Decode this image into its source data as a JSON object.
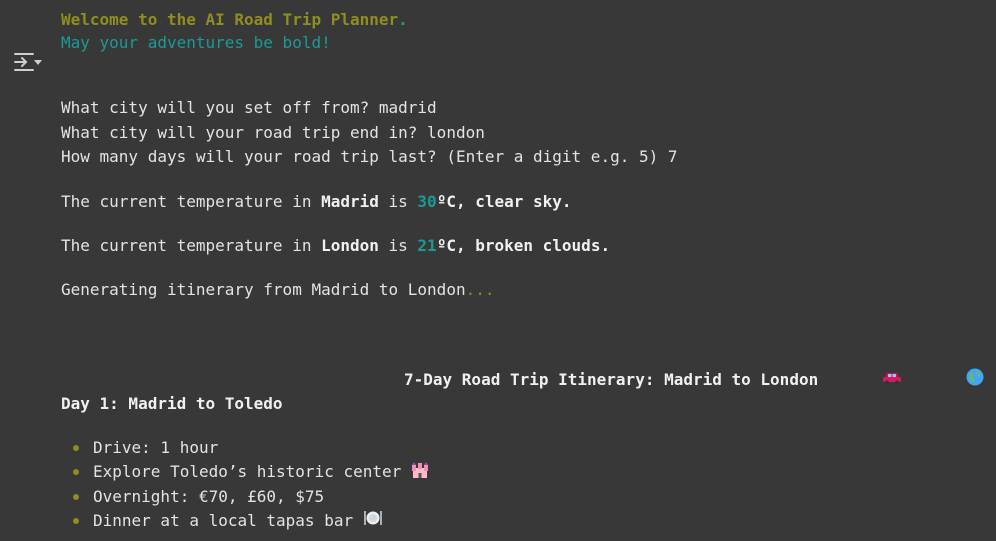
{
  "toolbar": {
    "output_icon": "output-collapse-icon"
  },
  "welcome": {
    "line1_prefix": "Welcome to the AI Road Trip Planner",
    "line1_suffix": ".",
    "line2": "May your adventures be bold!"
  },
  "prompts": [
    {
      "question": "What city will you set off from? ",
      "answer": "madrid"
    },
    {
      "question": "What city will your road trip end in? ",
      "answer": "london"
    },
    {
      "question": "How many days will your road trip last? (Enter a digit e.g. 5) ",
      "answer": "7"
    }
  ],
  "weather": [
    {
      "prefix": "The current temperature in ",
      "city": "Madrid",
      "mid": " is ",
      "temp": "30",
      "suffix": "ºC, clear sky."
    },
    {
      "prefix": "The current temperature in ",
      "city": "London",
      "mid": " is ",
      "temp": "21",
      "suffix": "ºC, broken clouds."
    }
  ],
  "generating": {
    "text": "Generating itinerary from Madrid to London",
    "dots": "..."
  },
  "itinerary": {
    "title": "7-Day Road Trip Itinerary: Madrid to London",
    "title_icons": [
      "car-icon",
      "globe-icon"
    ],
    "day1": {
      "heading": "Day 1: Madrid to Toledo",
      "items": [
        {
          "text": "Drive: 1 hour",
          "icon": ""
        },
        {
          "text": "Explore Toledo’s historic center ",
          "icon": "castle-icon"
        },
        {
          "text": "Overnight: €70, £60, $75",
          "icon": ""
        },
        {
          "text": "Dinner at a local tapas bar ",
          "icon": "plate-icon"
        }
      ]
    }
  }
}
